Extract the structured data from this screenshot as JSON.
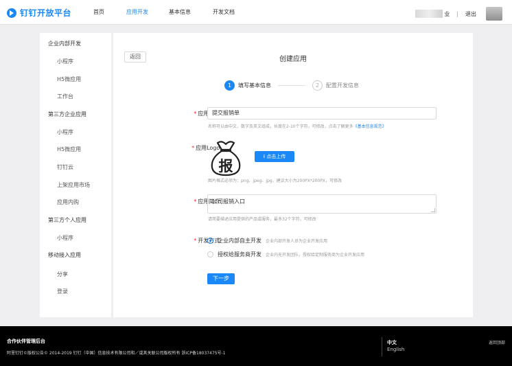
{
  "header": {
    "brand": "钉钉开放平台",
    "nav": [
      "首页",
      "应用开发",
      "基本信息",
      "开发文档"
    ],
    "user_suffix": "业",
    "separator": "|",
    "logout": "退出"
  },
  "sidebar": {
    "items": [
      {
        "label": "企业内部开发",
        "type": "section"
      },
      {
        "label": "小程序",
        "type": "child"
      },
      {
        "label": "H5微应用",
        "type": "child"
      },
      {
        "label": "工作台",
        "type": "child"
      },
      {
        "label": "第三方企业应用",
        "type": "section"
      },
      {
        "label": "小程序",
        "type": "child"
      },
      {
        "label": "H5微应用",
        "type": "child"
      },
      {
        "label": "钉钉云",
        "type": "child"
      },
      {
        "label": "上架应用市场",
        "type": "child"
      },
      {
        "label": "应用内购",
        "type": "child"
      },
      {
        "label": "第三方个人应用",
        "type": "section"
      },
      {
        "label": "小程序",
        "type": "child"
      },
      {
        "label": "移动接入应用",
        "type": "section"
      },
      {
        "label": "分享",
        "type": "child"
      },
      {
        "label": "登录",
        "type": "child"
      }
    ]
  },
  "main": {
    "back_label": "返回",
    "title": "创建应用",
    "steps": [
      {
        "num": "1",
        "label": "填写基本信息"
      },
      {
        "num": "2",
        "label": "配置开发信息"
      }
    ],
    "name_field": {
      "label": "应用名称:",
      "value": "提交报销单",
      "hint": "名称可以由中文、数字及英文组成，长度在2-10个字符，可修改，点击了解更多",
      "hint_link": "《基本信息规范》"
    },
    "logo_field": {
      "label": "应用Logo:",
      "logo_char": "报",
      "upload_label": "点击上传",
      "hint": "图片格式必须为：png、jpeg、jpg，建议大小为200PX*200PX，可修改"
    },
    "desc_field": {
      "label": "应用简介:",
      "value": "公司报销入口",
      "hint": "请简要描述应用提供的产品或服务，最多32个字符，可修改"
    },
    "dev_field": {
      "label": "开发方式:",
      "options": [
        {
          "label": "企业内部自主开发",
          "desc": "企业内部开发人员为企业开发应用",
          "checked": true
        },
        {
          "label": "授权给服务商开发",
          "desc": "企业内无开发团队，授权给定制服务商为企业开发应用",
          "checked": false
        }
      ]
    },
    "next_label": "下一步"
  },
  "footer": {
    "title": "合作伙伴管理后台",
    "copyright": "阿里钉钉©版权公告© 2014-2019 钉钉（中国）信息技术有限公司和／或其关联公司版权所有 浙ICP备18037475号-1",
    "lang_zh": "中文",
    "lang_en": "English",
    "back_top": "返回顶部"
  },
  "colors": {
    "accent": "#1b88f7",
    "required": "#f5222d",
    "footer_bg": "#000000",
    "page_bg": "#efeff1"
  },
  "icons": [
    "dingtalk-logo-icon",
    "upload-icon",
    "money-bag-icon"
  ]
}
